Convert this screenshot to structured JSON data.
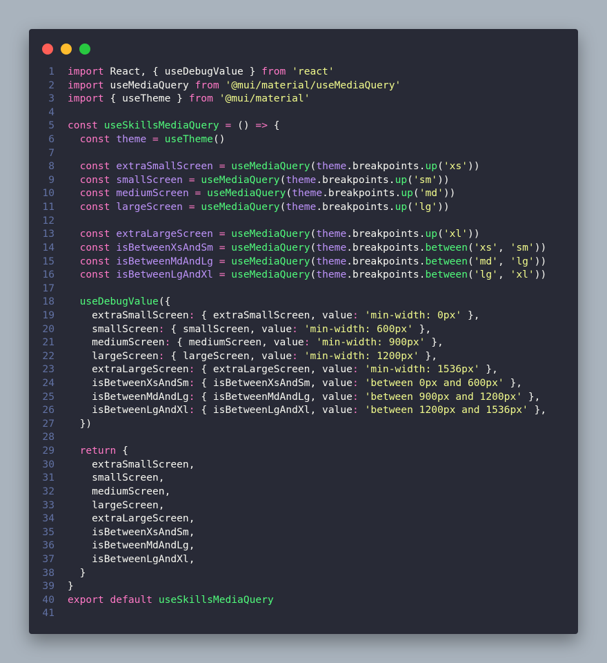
{
  "window": {
    "controls": [
      "close",
      "minimize",
      "maximize"
    ]
  },
  "theme": {
    "background": "#282a36",
    "keyword": "#ff79c6",
    "string": "#f1fa8c",
    "function": "#bd93f9",
    "call": "#50fa7b",
    "default": "#f8f8f2",
    "gutter": "#6272a4"
  },
  "lines": [
    [
      [
        "k",
        "import"
      ],
      [
        "b",
        " React, { useDebugValue } "
      ],
      [
        "k",
        "from"
      ],
      [
        "b",
        " "
      ],
      [
        "s",
        "'react'"
      ]
    ],
    [
      [
        "k",
        "import"
      ],
      [
        "b",
        " useMediaQuery "
      ],
      [
        "k",
        "from"
      ],
      [
        "b",
        " "
      ],
      [
        "s",
        "'@mui/material/useMediaQuery'"
      ]
    ],
    [
      [
        "k",
        "import"
      ],
      [
        "b",
        " { useTheme } "
      ],
      [
        "k",
        "from"
      ],
      [
        "b",
        " "
      ],
      [
        "s",
        "'@mui/material'"
      ]
    ],
    [],
    [
      [
        "k",
        "const"
      ],
      [
        "b",
        " "
      ],
      [
        "fn",
        "useSkillsMediaQuery"
      ],
      [
        "b",
        " "
      ],
      [
        "k",
        "="
      ],
      [
        "b",
        " () "
      ],
      [
        "k",
        "=>"
      ],
      [
        "b",
        " {"
      ]
    ],
    [
      [
        "b",
        "  "
      ],
      [
        "k",
        "const"
      ],
      [
        "b",
        " "
      ],
      [
        "f",
        "theme"
      ],
      [
        "b",
        " "
      ],
      [
        "k",
        "="
      ],
      [
        "b",
        " "
      ],
      [
        "fn",
        "useTheme"
      ],
      [
        "b",
        "()"
      ]
    ],
    [],
    [
      [
        "b",
        "  "
      ],
      [
        "k",
        "const"
      ],
      [
        "b",
        " "
      ],
      [
        "f",
        "extraSmallScreen"
      ],
      [
        "b",
        " "
      ],
      [
        "k",
        "="
      ],
      [
        "b",
        " "
      ],
      [
        "fn",
        "useMediaQuery"
      ],
      [
        "b",
        "("
      ],
      [
        "f",
        "theme"
      ],
      [
        "b",
        ".breakpoints."
      ],
      [
        "fn",
        "up"
      ],
      [
        "b",
        "("
      ],
      [
        "s",
        "'xs'"
      ],
      [
        "b",
        "))"
      ]
    ],
    [
      [
        "b",
        "  "
      ],
      [
        "k",
        "const"
      ],
      [
        "b",
        " "
      ],
      [
        "f",
        "smallScreen"
      ],
      [
        "b",
        " "
      ],
      [
        "k",
        "="
      ],
      [
        "b",
        " "
      ],
      [
        "fn",
        "useMediaQuery"
      ],
      [
        "b",
        "("
      ],
      [
        "f",
        "theme"
      ],
      [
        "b",
        ".breakpoints."
      ],
      [
        "fn",
        "up"
      ],
      [
        "b",
        "("
      ],
      [
        "s",
        "'sm'"
      ],
      [
        "b",
        "))"
      ]
    ],
    [
      [
        "b",
        "  "
      ],
      [
        "k",
        "const"
      ],
      [
        "b",
        " "
      ],
      [
        "f",
        "mediumScreen"
      ],
      [
        "b",
        " "
      ],
      [
        "k",
        "="
      ],
      [
        "b",
        " "
      ],
      [
        "fn",
        "useMediaQuery"
      ],
      [
        "b",
        "("
      ],
      [
        "f",
        "theme"
      ],
      [
        "b",
        ".breakpoints."
      ],
      [
        "fn",
        "up"
      ],
      [
        "b",
        "("
      ],
      [
        "s",
        "'md'"
      ],
      [
        "b",
        "))"
      ]
    ],
    [
      [
        "b",
        "  "
      ],
      [
        "k",
        "const"
      ],
      [
        "b",
        " "
      ],
      [
        "f",
        "largeScreen"
      ],
      [
        "b",
        " "
      ],
      [
        "k",
        "="
      ],
      [
        "b",
        " "
      ],
      [
        "fn",
        "useMediaQuery"
      ],
      [
        "b",
        "("
      ],
      [
        "f",
        "theme"
      ],
      [
        "b",
        ".breakpoints."
      ],
      [
        "fn",
        "up"
      ],
      [
        "b",
        "("
      ],
      [
        "s",
        "'lg'"
      ],
      [
        "b",
        "))"
      ]
    ],
    [],
    [
      [
        "b",
        "  "
      ],
      [
        "k",
        "const"
      ],
      [
        "b",
        " "
      ],
      [
        "f",
        "extraLargeScreen"
      ],
      [
        "b",
        " "
      ],
      [
        "k",
        "="
      ],
      [
        "b",
        " "
      ],
      [
        "fn",
        "useMediaQuery"
      ],
      [
        "b",
        "("
      ],
      [
        "f",
        "theme"
      ],
      [
        "b",
        ".breakpoints."
      ],
      [
        "fn",
        "up"
      ],
      [
        "b",
        "("
      ],
      [
        "s",
        "'xl'"
      ],
      [
        "b",
        "))"
      ]
    ],
    [
      [
        "b",
        "  "
      ],
      [
        "k",
        "const"
      ],
      [
        "b",
        " "
      ],
      [
        "f",
        "isBetweenXsAndSm"
      ],
      [
        "b",
        " "
      ],
      [
        "k",
        "="
      ],
      [
        "b",
        " "
      ],
      [
        "fn",
        "useMediaQuery"
      ],
      [
        "b",
        "("
      ],
      [
        "f",
        "theme"
      ],
      [
        "b",
        ".breakpoints."
      ],
      [
        "fn",
        "between"
      ],
      [
        "b",
        "("
      ],
      [
        "s",
        "'xs'"
      ],
      [
        "b",
        ", "
      ],
      [
        "s",
        "'sm'"
      ],
      [
        "b",
        "))"
      ]
    ],
    [
      [
        "b",
        "  "
      ],
      [
        "k",
        "const"
      ],
      [
        "b",
        " "
      ],
      [
        "f",
        "isBetweenMdAndLg"
      ],
      [
        "b",
        " "
      ],
      [
        "k",
        "="
      ],
      [
        "b",
        " "
      ],
      [
        "fn",
        "useMediaQuery"
      ],
      [
        "b",
        "("
      ],
      [
        "f",
        "theme"
      ],
      [
        "b",
        ".breakpoints."
      ],
      [
        "fn",
        "between"
      ],
      [
        "b",
        "("
      ],
      [
        "s",
        "'md'"
      ],
      [
        "b",
        ", "
      ],
      [
        "s",
        "'lg'"
      ],
      [
        "b",
        "))"
      ]
    ],
    [
      [
        "b",
        "  "
      ],
      [
        "k",
        "const"
      ],
      [
        "b",
        " "
      ],
      [
        "f",
        "isBetweenLgAndXl"
      ],
      [
        "b",
        " "
      ],
      [
        "k",
        "="
      ],
      [
        "b",
        " "
      ],
      [
        "fn",
        "useMediaQuery"
      ],
      [
        "b",
        "("
      ],
      [
        "f",
        "theme"
      ],
      [
        "b",
        ".breakpoints."
      ],
      [
        "fn",
        "between"
      ],
      [
        "b",
        "("
      ],
      [
        "s",
        "'lg'"
      ],
      [
        "b",
        ", "
      ],
      [
        "s",
        "'xl'"
      ],
      [
        "b",
        "))"
      ]
    ],
    [],
    [
      [
        "b",
        "  "
      ],
      [
        "fn",
        "useDebugValue"
      ],
      [
        "b",
        "({"
      ]
    ],
    [
      [
        "b",
        "    extraSmallScreen"
      ],
      [
        "k",
        ":"
      ],
      [
        "b",
        " { extraSmallScreen, value"
      ],
      [
        "k",
        ":"
      ],
      [
        "b",
        " "
      ],
      [
        "s",
        "'min-width: 0px'"
      ],
      [
        "b",
        " },"
      ]
    ],
    [
      [
        "b",
        "    smallScreen"
      ],
      [
        "k",
        ":"
      ],
      [
        "b",
        " { smallScreen, value"
      ],
      [
        "k",
        ":"
      ],
      [
        "b",
        " "
      ],
      [
        "s",
        "'min-width: 600px'"
      ],
      [
        "b",
        " },"
      ]
    ],
    [
      [
        "b",
        "    mediumScreen"
      ],
      [
        "k",
        ":"
      ],
      [
        "b",
        " { mediumScreen, value"
      ],
      [
        "k",
        ":"
      ],
      [
        "b",
        " "
      ],
      [
        "s",
        "'min-width: 900px'"
      ],
      [
        "b",
        " },"
      ]
    ],
    [
      [
        "b",
        "    largeScreen"
      ],
      [
        "k",
        ":"
      ],
      [
        "b",
        " { largeScreen, value"
      ],
      [
        "k",
        ":"
      ],
      [
        "b",
        " "
      ],
      [
        "s",
        "'min-width: 1200px'"
      ],
      [
        "b",
        " },"
      ]
    ],
    [
      [
        "b",
        "    extraLargeScreen"
      ],
      [
        "k",
        ":"
      ],
      [
        "b",
        " { extraLargeScreen, value"
      ],
      [
        "k",
        ":"
      ],
      [
        "b",
        " "
      ],
      [
        "s",
        "'min-width: 1536px'"
      ],
      [
        "b",
        " },"
      ]
    ],
    [
      [
        "b",
        "    isBetweenXsAndSm"
      ],
      [
        "k",
        ":"
      ],
      [
        "b",
        " { isBetweenXsAndSm, value"
      ],
      [
        "k",
        ":"
      ],
      [
        "b",
        " "
      ],
      [
        "s",
        "'between 0px and 600px'"
      ],
      [
        "b",
        " },"
      ]
    ],
    [
      [
        "b",
        "    isBetweenMdAndLg"
      ],
      [
        "k",
        ":"
      ],
      [
        "b",
        " { isBetweenMdAndLg, value"
      ],
      [
        "k",
        ":"
      ],
      [
        "b",
        " "
      ],
      [
        "s",
        "'between 900px and 1200px'"
      ],
      [
        "b",
        " },"
      ]
    ],
    [
      [
        "b",
        "    isBetweenLgAndXl"
      ],
      [
        "k",
        ":"
      ],
      [
        "b",
        " { isBetweenLgAndXl, value"
      ],
      [
        "k",
        ":"
      ],
      [
        "b",
        " "
      ],
      [
        "s",
        "'between 1200px and 1536px'"
      ],
      [
        "b",
        " },"
      ]
    ],
    [
      [
        "b",
        "  })"
      ]
    ],
    [],
    [
      [
        "b",
        "  "
      ],
      [
        "k",
        "return"
      ],
      [
        "b",
        " {"
      ]
    ],
    [
      [
        "b",
        "    extraSmallScreen,"
      ]
    ],
    [
      [
        "b",
        "    smallScreen,"
      ]
    ],
    [
      [
        "b",
        "    mediumScreen,"
      ]
    ],
    [
      [
        "b",
        "    largeScreen,"
      ]
    ],
    [
      [
        "b",
        "    extraLargeScreen,"
      ]
    ],
    [
      [
        "b",
        "    isBetweenXsAndSm,"
      ]
    ],
    [
      [
        "b",
        "    isBetweenMdAndLg,"
      ]
    ],
    [
      [
        "b",
        "    isBetweenLgAndXl,"
      ]
    ],
    [
      [
        "b",
        "  }"
      ]
    ],
    [
      [
        "b",
        "}"
      ]
    ],
    [
      [
        "k",
        "export"
      ],
      [
        "b",
        " "
      ],
      [
        "k",
        "default"
      ],
      [
        "b",
        " "
      ],
      [
        "fn",
        "useSkillsMediaQuery"
      ]
    ],
    []
  ]
}
